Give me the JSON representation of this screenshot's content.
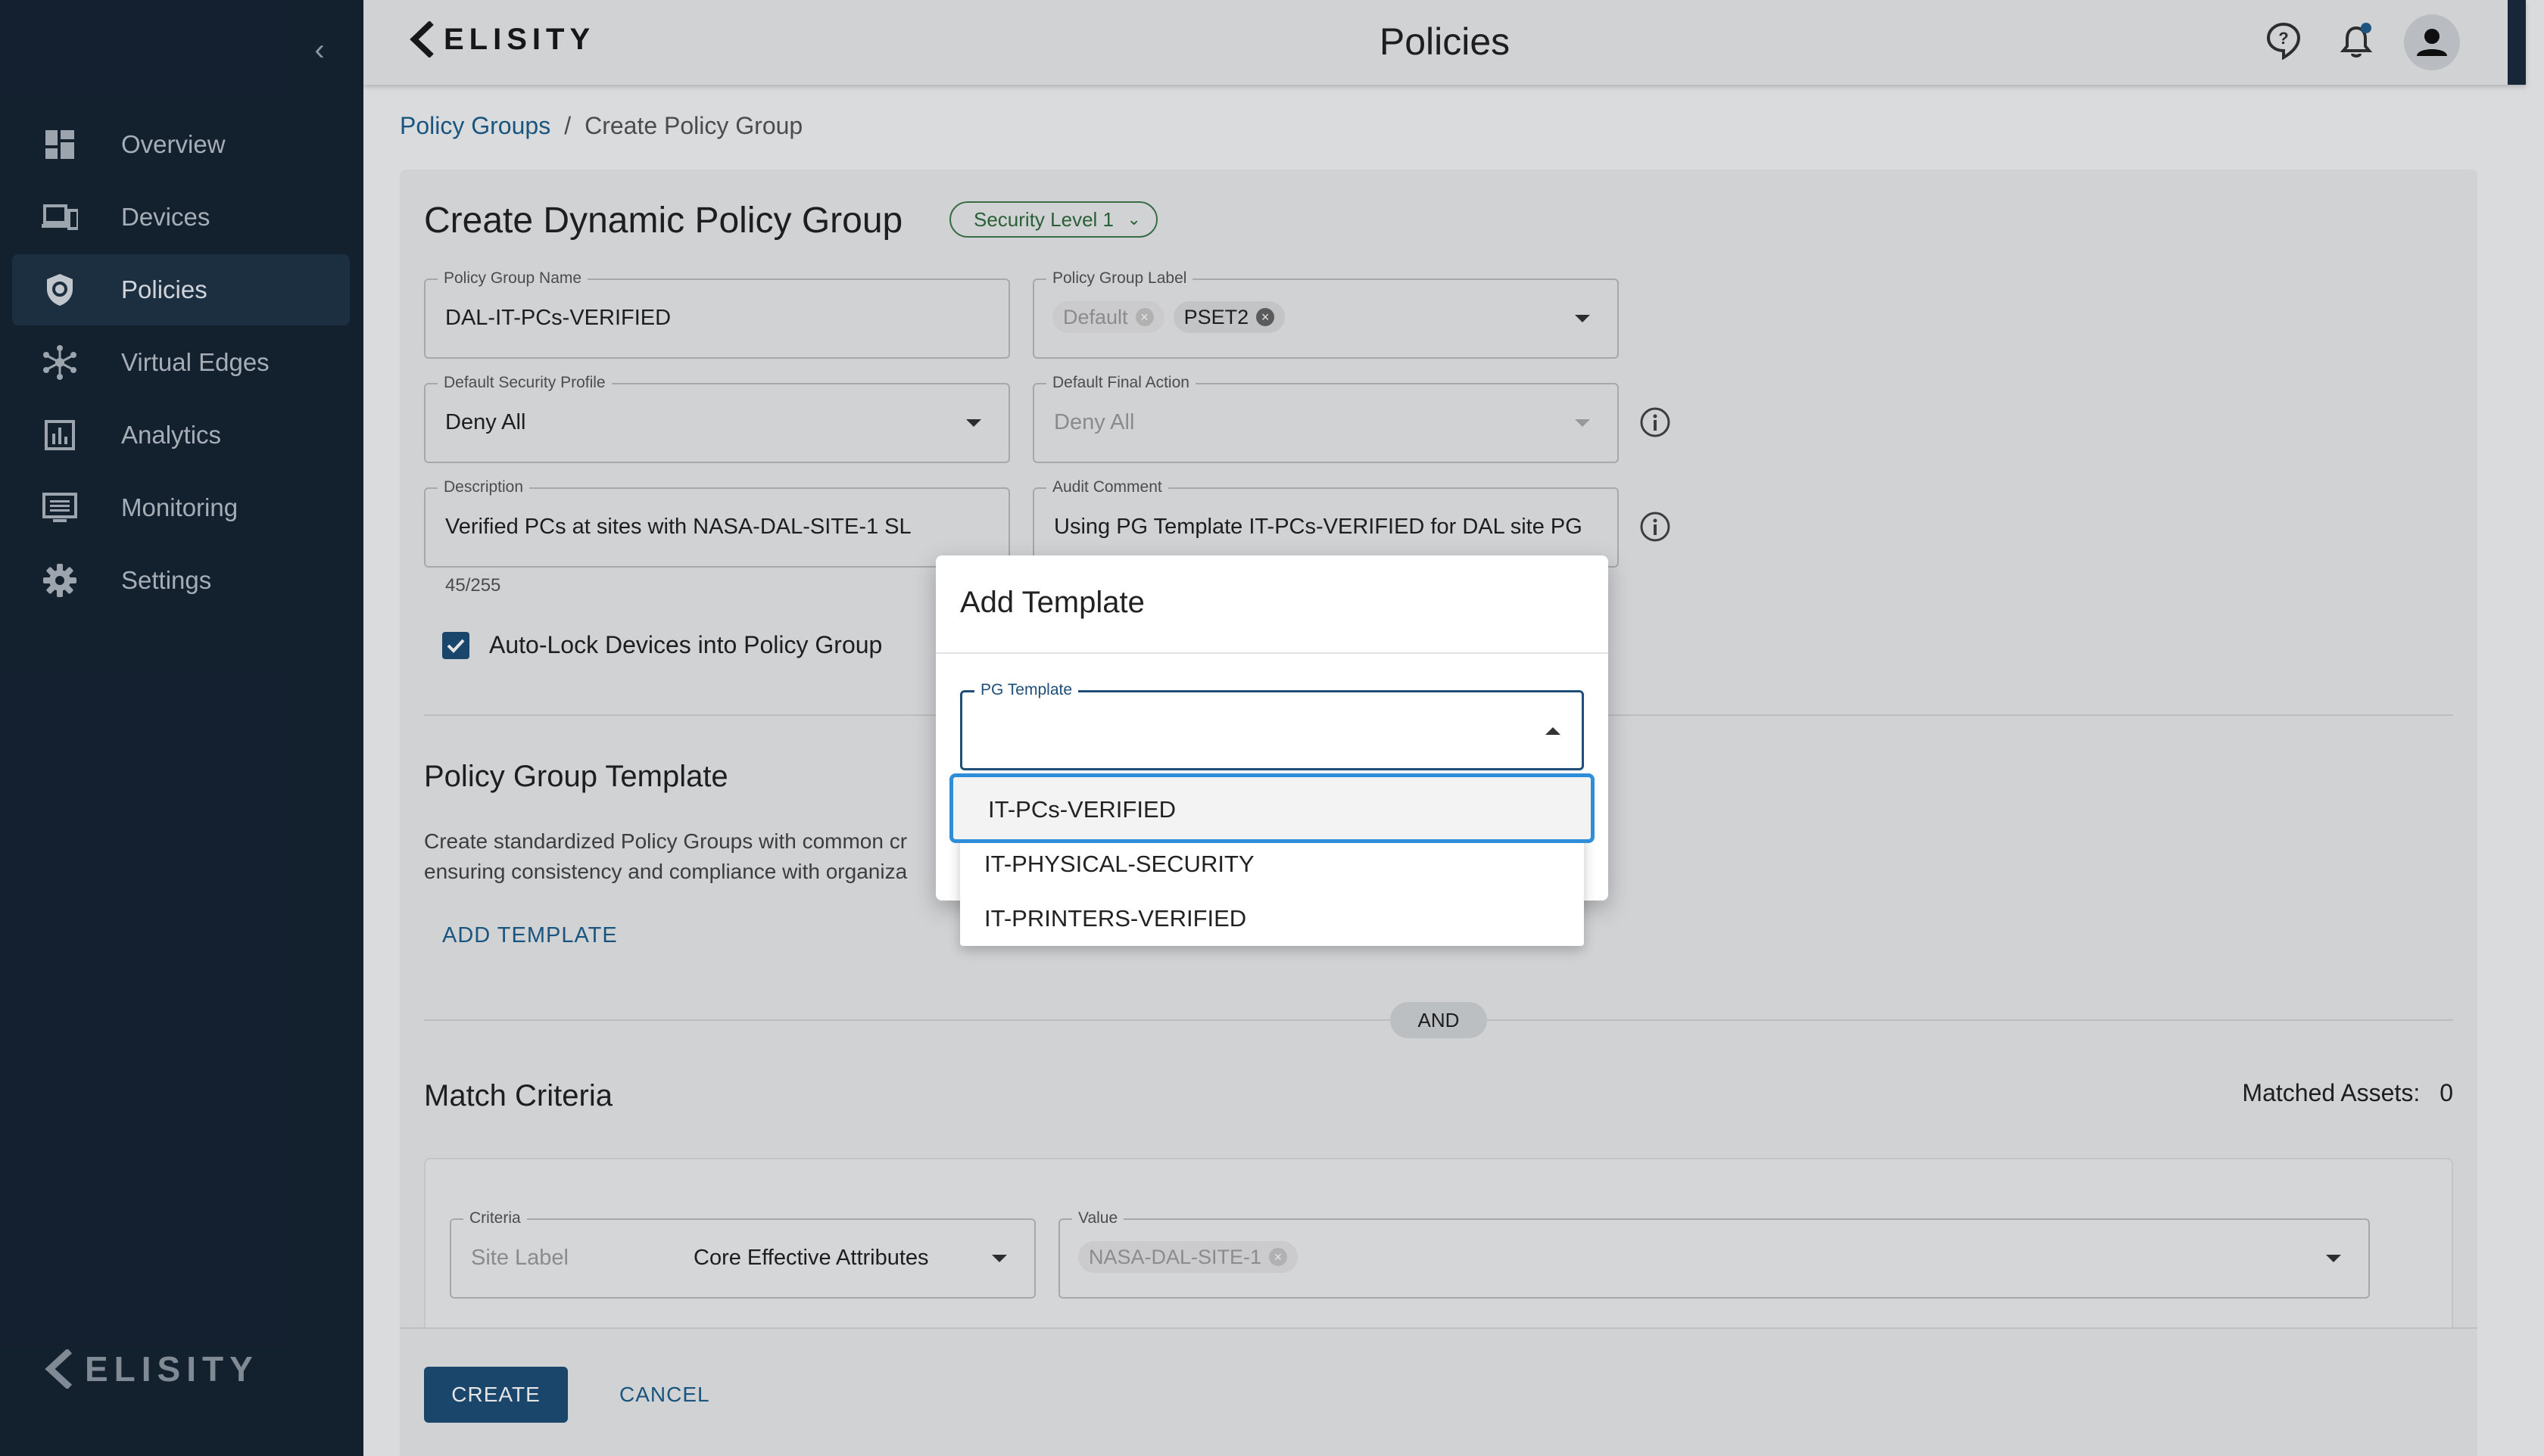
{
  "header": {
    "brand": "ELISITY",
    "title": "Policies"
  },
  "sidebar": {
    "items": [
      {
        "label": "Overview",
        "icon": "dashboard-grid-icon"
      },
      {
        "label": "Devices",
        "icon": "devices-icon"
      },
      {
        "label": "Policies",
        "icon": "shield-icon",
        "active": true
      },
      {
        "label": "Virtual Edges",
        "icon": "network-nodes-icon"
      },
      {
        "label": "Analytics",
        "icon": "bar-chart-icon"
      },
      {
        "label": "Monitoring",
        "icon": "monitor-list-icon"
      },
      {
        "label": "Settings",
        "icon": "gear-icon"
      }
    ],
    "logo": "ELISITY"
  },
  "breadcrumb": {
    "parent": "Policy Groups",
    "separator": "/",
    "current": "Create Policy Group"
  },
  "form": {
    "title": "Create Dynamic Policy Group",
    "security_chip": "Security Level 1",
    "policy_group_name": {
      "label": "Policy Group Name",
      "value": "DAL-IT-PCs-VERIFIED"
    },
    "policy_group_label": {
      "label": "Policy Group Label",
      "chips": [
        "Default",
        "PSET2"
      ]
    },
    "default_security_profile": {
      "label": "Default Security Profile",
      "value": "Deny All"
    },
    "default_final_action": {
      "label": "Default Final Action",
      "value": "Deny All"
    },
    "description": {
      "label": "Description",
      "value": "Verified PCs at sites with NASA-DAL-SITE-1 SL",
      "count": "45/255"
    },
    "audit_comment": {
      "label": "Audit Comment",
      "value": "Using PG Template IT-PCs-VERIFIED for DAL site PG"
    },
    "auto_lock": {
      "label": "Auto-Lock Devices into Policy Group",
      "checked": true
    }
  },
  "template_section": {
    "title": "Policy Group Template",
    "description_line1": "Create standardized Policy Groups with common cr",
    "description_line2": "ensuring consistency and compliance with organiza",
    "add_link": "ADD TEMPLATE"
  },
  "and_badge": "AND",
  "match_criteria": {
    "title": "Match Criteria",
    "matched_label": "Matched Assets:",
    "matched_value": "0",
    "criteria": {
      "label": "Criteria",
      "placeholder": "Site Label",
      "value": "Core Effective Attributes"
    },
    "value": {
      "label": "Value",
      "chip": "NASA-DAL-SITE-1"
    }
  },
  "footer": {
    "create": "CREATE",
    "cancel": "CANCEL"
  },
  "modal": {
    "title": "Add Template",
    "select_label": "PG Template",
    "options": [
      "IT-PCs-VERIFIED",
      "IT-PHYSICAL-SECURITY",
      "IT-PRINTERS-VERIFIED"
    ]
  },
  "colors": {
    "sidebar_bg": "#162434",
    "primary": "#1f4e79",
    "focus_ring": "#2e8fd8",
    "link": "#1c5f8e"
  }
}
